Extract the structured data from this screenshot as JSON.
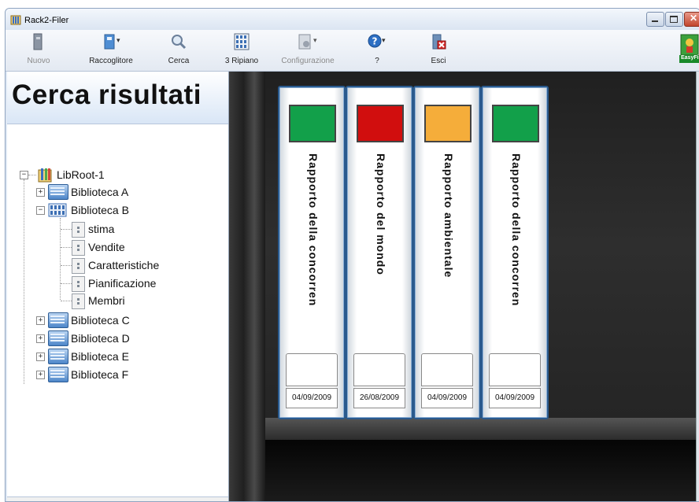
{
  "window": {
    "title": "Rack2-Filer"
  },
  "toolbar": {
    "items": [
      {
        "label": "Nuovo",
        "icon": "new-icon",
        "disabled": true
      },
      {
        "label": "Raccoglitore",
        "icon": "binder-icon",
        "disabled": false
      },
      {
        "label": "Cerca",
        "icon": "search-icon",
        "disabled": false
      },
      {
        "label": "3 Ripiano",
        "icon": "shelf-grid-icon",
        "disabled": false
      },
      {
        "label": "Configurazione",
        "icon": "config-icon",
        "disabled": true
      },
      {
        "label": "?",
        "icon": "help-icon",
        "disabled": false
      },
      {
        "label": "Esci",
        "icon": "exit-icon",
        "disabled": false
      }
    ],
    "brand_label": "EasyFi"
  },
  "panel": {
    "title": "Cerca risultati"
  },
  "tree": {
    "root": "LibRoot-1",
    "libraries": [
      "Biblioteca A",
      "Biblioteca B",
      "Biblioteca C",
      "Biblioteca D",
      "Biblioteca E",
      "Biblioteca F"
    ],
    "expanded_children": [
      "stima",
      "Vendite",
      "Caratteristiche",
      "Pianificazione",
      "Membri"
    ]
  },
  "binders": [
    {
      "title": "Rapporto della concorren",
      "date": "04/09/2009",
      "color": "#12a04a"
    },
    {
      "title": "Rapporto del mondo",
      "date": "26/08/2009",
      "color": "#d10e0e"
    },
    {
      "title": "Rapporto ambientale",
      "date": "04/09/2009",
      "color": "#f5ad3a"
    },
    {
      "title": "Rapporto della concorren",
      "date": "04/09/2009",
      "color": "#12a04a"
    }
  ]
}
